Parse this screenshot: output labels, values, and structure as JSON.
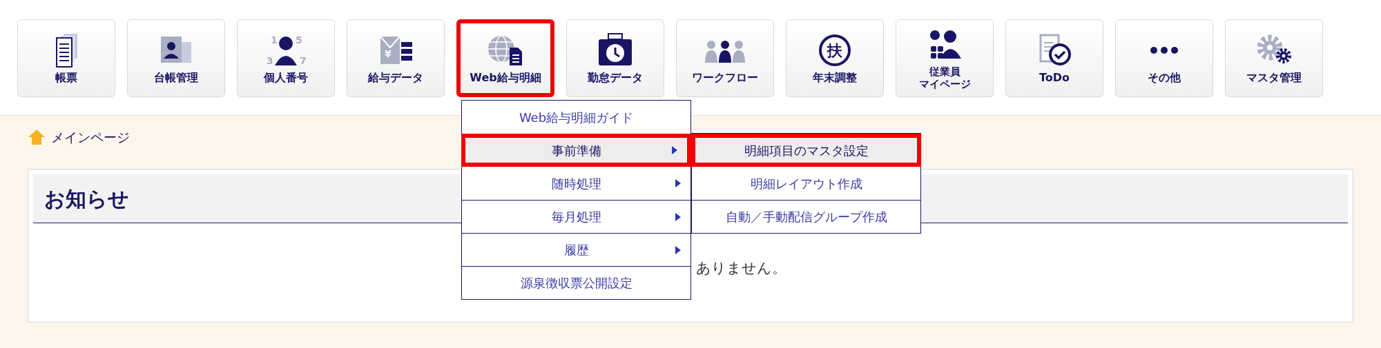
{
  "toolbar": [
    {
      "label": "帳票",
      "highlighted": false
    },
    {
      "label": "台帳管理",
      "highlighted": false
    },
    {
      "label": "個人番号",
      "highlighted": false,
      "icon_text": [
        "1",
        "5",
        "3",
        "7"
      ]
    },
    {
      "label": "給与データ",
      "highlighted": false,
      "icon_text": [
        "¥"
      ]
    },
    {
      "label": "Web給与明細",
      "highlighted": true
    },
    {
      "label": "勤怠データ",
      "highlighted": false
    },
    {
      "label": "ワークフロー",
      "highlighted": false
    },
    {
      "label": "年末調整",
      "highlighted": false,
      "icon_text": [
        "扶"
      ]
    },
    {
      "lines": [
        "従業員",
        "マイページ"
      ],
      "highlighted": false
    },
    {
      "label": "ToDo",
      "highlighted": false
    },
    {
      "label": "その他",
      "highlighted": false
    },
    {
      "label": "マスタ管理",
      "highlighted": false
    }
  ],
  "breadcrumb": "メインページ",
  "notice": {
    "title": "お知らせ",
    "message": "ありません。"
  },
  "menu": [
    {
      "label": "Web給与明細ガイド",
      "submenu": false,
      "selected": false
    },
    {
      "label": "事前準備",
      "submenu": true,
      "selected": true
    },
    {
      "label": "随時処理",
      "submenu": true,
      "selected": false
    },
    {
      "label": "毎月処理",
      "submenu": true,
      "selected": false
    },
    {
      "label": "履歴",
      "submenu": true,
      "selected": false
    },
    {
      "label": "源泉徴収票公開設定",
      "submenu": false,
      "selected": false
    }
  ],
  "submenu": [
    {
      "label": "明細項目のマスタ設定",
      "selected": true
    },
    {
      "label": "明細レイアウト作成",
      "selected": false
    },
    {
      "label": "自動／手動配信グループ作成",
      "selected": false
    }
  ]
}
